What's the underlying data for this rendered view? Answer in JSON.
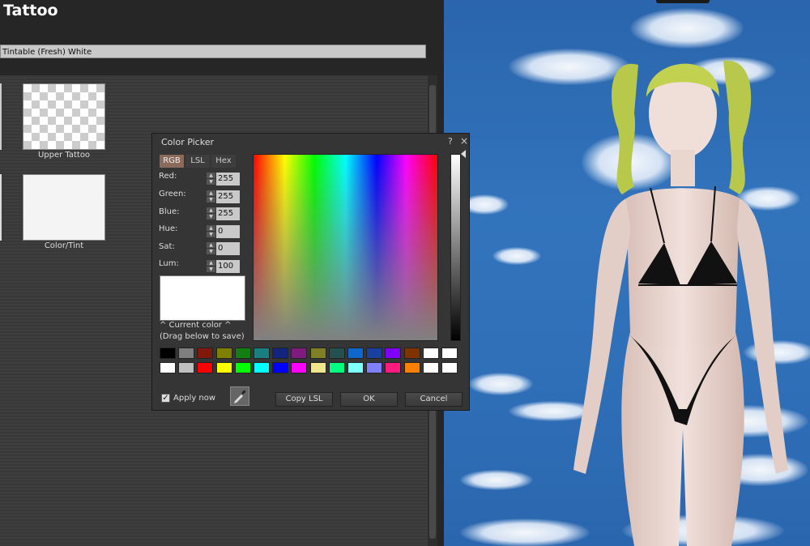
{
  "appearance": {
    "title": "Tattoo",
    "wearable_name": "Tintable (Fresh) White",
    "swatches": [
      {
        "label": "Upper Tattoo"
      },
      {
        "label": "Color/Tint"
      }
    ]
  },
  "color_picker": {
    "title": "Color Picker",
    "help_glyph": "?",
    "close_glyph": "×",
    "tabs": [
      {
        "label": "RGB",
        "active": true
      },
      {
        "label": "LSL",
        "active": false
      },
      {
        "label": "Hex",
        "active": false
      }
    ],
    "fields": [
      {
        "label": "Red:",
        "value": "255"
      },
      {
        "label": "Green:",
        "value": "255"
      },
      {
        "label": "Blue:",
        "value": "255"
      },
      {
        "label": "Hue:",
        "value": "0"
      },
      {
        "label": "Sat:",
        "value": "0"
      },
      {
        "label": "Lum:",
        "value": "100"
      }
    ],
    "current_color": "#ffffff",
    "current_color_caption": "^ Current color ^",
    "drag_hint": "(Drag below to save)",
    "palette_row1": [
      "#000000",
      "#7f7f7f",
      "#7f1a0a",
      "#7f7f00",
      "#137f13",
      "#1a7f7f",
      "#13247f",
      "#7f1a7f",
      "#7f7f26",
      "#264f4f",
      "#0f66cc",
      "#1a3f9f",
      "#7f00ff",
      "#7f3300",
      "#ffffff",
      "#ffffff"
    ],
    "palette_row2": [
      "#ffffff",
      "#bfbfbf",
      "#ff0000",
      "#ffff00",
      "#00ff00",
      "#00ffff",
      "#0000ff",
      "#ff00ff",
      "#f0e68c",
      "#00ff80",
      "#80ffff",
      "#8080ff",
      "#ff1a80",
      "#ff8000",
      "#ffffff",
      "#ffffff"
    ],
    "apply_now_label": "Apply now",
    "apply_now_checked": true,
    "buttons": {
      "copy_lsl": "Copy LSL",
      "ok": "OK",
      "cancel": "Cancel"
    },
    "accent_tab_color": "#8a6a5a"
  }
}
